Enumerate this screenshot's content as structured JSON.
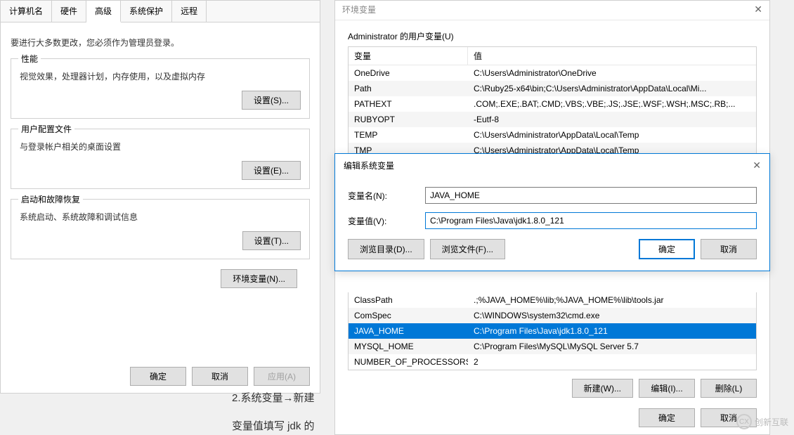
{
  "sys_props": {
    "tabs": [
      "计算机名",
      "硬件",
      "高级",
      "系统保护",
      "远程"
    ],
    "active_tab_index": 2,
    "admin_note": "要进行大多数更改，您必须作为管理员登录。",
    "perf": {
      "title": "性能",
      "desc": "视觉效果，处理器计划，内存使用，以及虚拟内存",
      "btn": "设置(S)..."
    },
    "profile": {
      "title": "用户配置文件",
      "desc": "与登录帐户相关的桌面设置",
      "btn": "设置(E)..."
    },
    "startup": {
      "title": "启动和故障恢复",
      "desc": "系统启动、系统故障和调试信息",
      "btn": "设置(T)..."
    },
    "env_btn": "环境变量(N)...",
    "footer": {
      "ok": "确定",
      "cancel": "取消",
      "apply": "应用(A)"
    }
  },
  "env_vars": {
    "bg_title": "环境变量",
    "user_section": "Administrator 的用户变量(U)",
    "headers": {
      "name": "变量",
      "value": "值"
    },
    "user_rows": [
      {
        "name": "OneDrive",
        "value": "C:\\Users\\Administrator\\OneDrive"
      },
      {
        "name": "Path",
        "value": "C:\\Ruby25-x64\\bin;C:\\Users\\Administrator\\AppData\\Local\\Mi..."
      },
      {
        "name": "PATHEXT",
        "value": ".COM;.EXE;.BAT;.CMD;.VBS;.VBE;.JS;.JSE;.WSF;.WSH;.MSC;.RB;..."
      },
      {
        "name": "RUBYOPT",
        "value": "-Eutf-8"
      },
      {
        "name": "TEMP",
        "value": "C:\\Users\\Administrator\\AppData\\Local\\Temp"
      },
      {
        "name": "TMP",
        "value": "C:\\Users\\Administrator\\AppData\\Local\\Temp"
      }
    ],
    "sys_rows": [
      {
        "name": "ClassPath",
        "value": ".;%JAVA_HOME%\\lib;%JAVA_HOME%\\lib\\tools.jar"
      },
      {
        "name": "ComSpec",
        "value": "C:\\WINDOWS\\system32\\cmd.exe"
      },
      {
        "name": "JAVA_HOME",
        "value": "C:\\Program Files\\Java\\jdk1.8.0_121",
        "selected": true
      },
      {
        "name": "MYSQL_HOME",
        "value": "C:\\Program Files\\MySQL\\MySQL Server 5.7"
      },
      {
        "name": "NUMBER_OF_PROCESSORS",
        "value": "2"
      }
    ],
    "btns": {
      "new": "新建(W)...",
      "edit": "编辑(I)...",
      "delete": "删除(L)"
    },
    "footer": {
      "ok": "确定",
      "cancel": "取消"
    }
  },
  "edit_var": {
    "title": "编辑系统变量",
    "name_label": "变量名(N):",
    "name_value": "JAVA_HOME",
    "value_label": "变量值(V):",
    "value_value": "C:\\Program Files\\Java\\jdk1.8.0_121",
    "browse_dir": "浏览目录(D)...",
    "browse_file": "浏览文件(F)...",
    "ok": "确定",
    "cancel": "取消"
  },
  "bottom_text1": "2.系统变量→新建",
  "bottom_text2": "变量值填写 jdk 的",
  "watermark": "创新互联"
}
